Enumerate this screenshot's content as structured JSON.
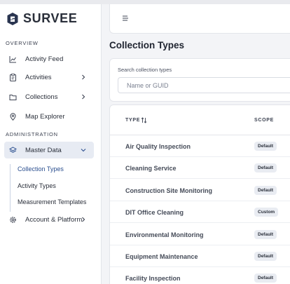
{
  "brand": {
    "name": "SURVEE"
  },
  "sidebar": {
    "overview_title": "OVERVIEW",
    "overview_items": [
      {
        "label": "Activity Feed",
        "icon": "chart-line-icon"
      },
      {
        "label": "Activities",
        "icon": "clipboard-icon"
      },
      {
        "label": "Collections",
        "icon": "folder-icon"
      },
      {
        "label": "Map Explorer",
        "icon": "map-pin-icon"
      }
    ],
    "admin_title": "ADMINISTRATION",
    "admin_items": [
      {
        "label": "Master Data",
        "icon": "layers-icon"
      },
      {
        "label": "Account & Platform",
        "icon": "gear-icon"
      }
    ],
    "master_data_sub": [
      "Collection Types",
      "Activity Types",
      "Measurement Templates"
    ]
  },
  "header": {
    "menu_icon": "hamburger-menu-icon"
  },
  "main": {
    "title": "Collection Types",
    "search": {
      "label": "Search collection types",
      "placeholder": "Name or GUID"
    },
    "table": {
      "columns": [
        "TYPE",
        "SCOPE"
      ],
      "rows": [
        {
          "name": "Air Quality Inspection",
          "scope": "Default"
        },
        {
          "name": "Cleaning Service",
          "scope": "Default"
        },
        {
          "name": "Construction Site Monitoring",
          "scope": "Default"
        },
        {
          "name": "DIT Office Cleaning",
          "scope": "Custom"
        },
        {
          "name": "Environmental Monitoring",
          "scope": "Default"
        },
        {
          "name": "Equipment Maintenance",
          "scope": "Default"
        },
        {
          "name": "Facility Inspection",
          "scope": "Default"
        }
      ]
    }
  },
  "colors": {
    "active_bg": "#e7ebf3",
    "active_text": "#2b4f8f",
    "badge_bg": "#e9ecf2"
  }
}
